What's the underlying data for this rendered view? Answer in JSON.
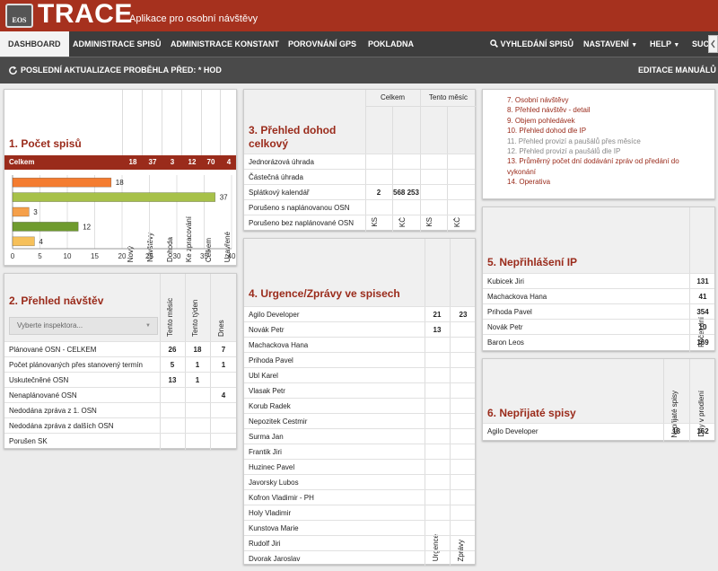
{
  "header": {
    "logo_text": "EOS",
    "app_title": "TRACE",
    "app_subtitle": "Aplikace pro osobní návštěvy"
  },
  "nav": {
    "items": [
      {
        "label": "DASHBOARD"
      },
      {
        "label": "ADMINISTRACE SPISŮ"
      },
      {
        "label": "ADMINISTRACE KONSTANT"
      },
      {
        "label": "POROVNÁNÍ GPS"
      },
      {
        "label": "POKLADNA"
      }
    ],
    "right": {
      "search": "VYHLEDÁNÍ SPISŮ",
      "settings": "NASTAVENÍ",
      "help": "HELP",
      "cut": "SUC"
    }
  },
  "infobar": {
    "last_update": "POSLEDNÍ AKTUALIZACE PROBĚHLA PŘED: * HOD",
    "edit_manuals": "EDITACE MANUÁLŮ"
  },
  "p1": {
    "title": "1. Počet spisů",
    "columns": [
      "Nový",
      "Návštěvy",
      "Dohoda",
      "Ke zpracování",
      "Celkem",
      "Uzavřené"
    ],
    "total_label": "Celkem",
    "total_values": [
      "18",
      "37",
      "3",
      "12",
      "70",
      "4"
    ]
  },
  "chart_data": {
    "type": "bar",
    "orientation": "horizontal",
    "categories": [
      "Nový",
      "Návštěvy",
      "Dohoda",
      "Ke zpracování",
      "Uzavřené"
    ],
    "values": [
      18,
      37,
      3,
      12,
      4
    ],
    "colors": [
      "#f47c30",
      "#a7c149",
      "#f5a04a",
      "#6f9b2e",
      "#f6c05a"
    ],
    "xlim": [
      0,
      40
    ],
    "xticks": [
      0,
      5,
      10,
      15,
      20,
      25,
      30,
      35,
      40
    ],
    "grid": true
  },
  "p2": {
    "title": "2. Přehled návštěv",
    "columns": [
      "Tento měsíc",
      "Tento týden",
      "Dnes"
    ],
    "select_placeholder": "Vyberte inspektora...",
    "rows": [
      {
        "label": "Plánované OSN - CELKEM",
        "v": [
          "26",
          "18",
          "7"
        ]
      },
      {
        "label": "Počet plánovaných přes stanovený termín",
        "v": [
          "5",
          "1",
          "1"
        ]
      },
      {
        "label": "Uskutečněné OSN",
        "v": [
          "13",
          "1",
          ""
        ]
      },
      {
        "label": "Nenaplánované OSN",
        "v": [
          "",
          "",
          "4"
        ]
      },
      {
        "label": "Nedodána zpráva z 1. OSN",
        "v": [
          "",
          "",
          ""
        ]
      },
      {
        "label": "Nedodána zpráva z dalších OSN",
        "v": [
          "",
          "",
          ""
        ]
      },
      {
        "label": "Porušen SK",
        "v": [
          "",
          "",
          ""
        ]
      }
    ]
  },
  "p3": {
    "title_line1": "3. Přehled dohod",
    "title_line2": "celkový",
    "group_total": "Celkem",
    "group_month": "Tento měsíc",
    "sub": [
      "KS",
      "KČ",
      "KS",
      "KČ"
    ],
    "rows": [
      {
        "label": "Jednorázová úhrada",
        "v": [
          "",
          "",
          "",
          ""
        ]
      },
      {
        "label": "Částečná úhrada",
        "v": [
          "",
          "",
          "",
          ""
        ]
      },
      {
        "label": "Splátkový kalendář",
        "v": [
          "2",
          "568 253",
          "",
          ""
        ]
      },
      {
        "label": "Porušeno s naplánovanou OSN",
        "v": [
          "",
          "",
          "",
          ""
        ]
      },
      {
        "label": "Porušeno bez naplánované OSN",
        "v": [
          "",
          "",
          "",
          ""
        ]
      }
    ]
  },
  "p4": {
    "title": "4. Urgence/Zprávy ve spisech",
    "columns": [
      "Urgence",
      "Zprávy"
    ],
    "rows": [
      {
        "label": "Agilo Developer",
        "v": [
          "21",
          "23"
        ]
      },
      {
        "label": "Novák Petr",
        "v": [
          "13",
          ""
        ]
      },
      {
        "label": "Machackova Hana",
        "v": [
          "",
          ""
        ]
      },
      {
        "label": "Prihoda Pavel",
        "v": [
          "",
          ""
        ]
      },
      {
        "label": "Ubl Karel",
        "v": [
          "",
          ""
        ]
      },
      {
        "label": "Vlasak Petr",
        "v": [
          "",
          ""
        ]
      },
      {
        "label": "Korub Radek",
        "v": [
          "",
          ""
        ]
      },
      {
        "label": "Nepozitek Cestmir",
        "v": [
          "",
          ""
        ]
      },
      {
        "label": "Surma Jan",
        "v": [
          "",
          ""
        ]
      },
      {
        "label": "Frantik Jiri",
        "v": [
          "",
          ""
        ]
      },
      {
        "label": "Huzinec Pavel",
        "v": [
          "",
          ""
        ]
      },
      {
        "label": "Javorsky Lubos",
        "v": [
          "",
          ""
        ]
      },
      {
        "label": "Kofron Vladimir - PH",
        "v": [
          "",
          ""
        ]
      },
      {
        "label": "Holy Vladimir",
        "v": [
          "",
          ""
        ]
      },
      {
        "label": "Kunstova Marie",
        "v": [
          "",
          ""
        ]
      },
      {
        "label": "Rudolf Jiri",
        "v": [
          "",
          ""
        ]
      },
      {
        "label": "Dvorak Jaroslav",
        "v": [
          "",
          ""
        ]
      }
    ]
  },
  "links": {
    "items": [
      {
        "label": "7. Osobní návštěvy",
        "gray": false
      },
      {
        "label": "8. Přehled návštěv - detail",
        "gray": false
      },
      {
        "label": "9. Objem pohledávek",
        "gray": false
      },
      {
        "label": "10. Přehled dohod dle IP",
        "gray": false
      },
      {
        "label": "11. Přehled provizí a paušálů přes měsíce",
        "gray": true
      },
      {
        "label": "12. Přehled provizí a paušálů dle IP",
        "gray": true
      },
      {
        "label": "13. Průměrný počet dní dodávání zpráv od předání do",
        "gray": false
      },
      {
        "label": "vykonání",
        "gray": false
      },
      {
        "label": "14. Operativa",
        "gray": false
      }
    ]
  },
  "p5": {
    "title": "5. Nepřihlášení IP",
    "column": "Počet dní",
    "rows": [
      {
        "label": "Kubicek Jiri",
        "v": "131"
      },
      {
        "label": "Machackova Hana",
        "v": "41"
      },
      {
        "label": "Prihoda Pavel",
        "v": "354"
      },
      {
        "label": "Novák Petr",
        "v": "10"
      },
      {
        "label": "Baron Leos",
        "v": "169"
      }
    ]
  },
  "p6": {
    "title": "6. Nepřijaté spisy",
    "columns": [
      "Nepřijaté spisy",
      "Dny v prodlení"
    ],
    "rows": [
      {
        "label": "Agilo Developer",
        "v": [
          "18",
          "162"
        ]
      }
    ]
  }
}
